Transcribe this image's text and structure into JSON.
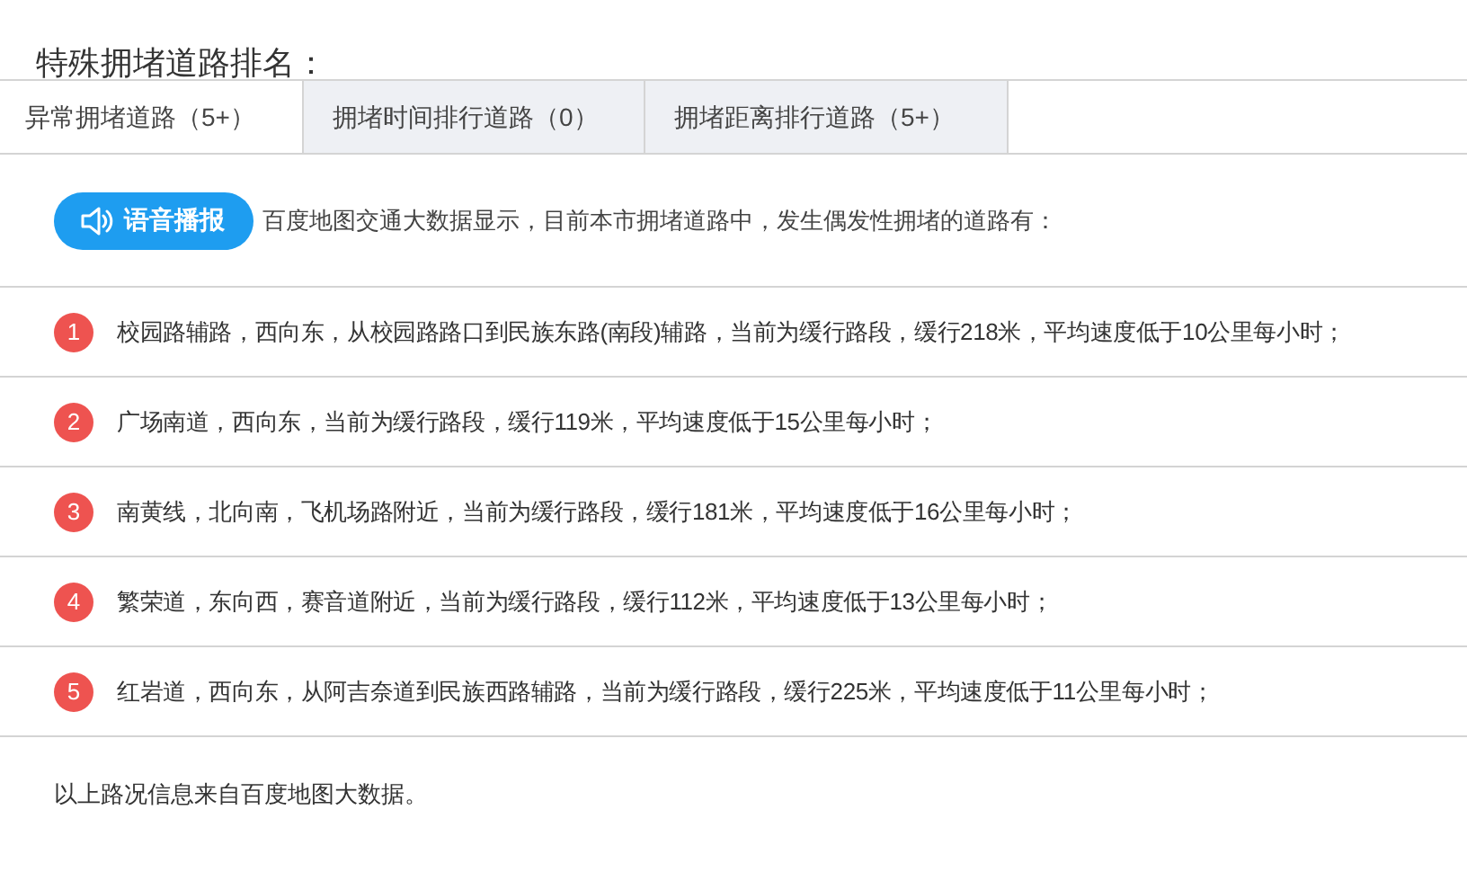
{
  "title": "特殊拥堵道路排名：",
  "tabs": [
    {
      "label": "异常拥堵道路（5+）",
      "selected": true
    },
    {
      "label": "拥堵时间排行道路（0）",
      "selected": false
    },
    {
      "label": "拥堵距离排行道路（5+）",
      "selected": false
    }
  ],
  "voice_button": {
    "label": "语音播报"
  },
  "intro": "百度地图交通大数据显示，目前本市拥堵道路中，发生偶发性拥堵的道路有：",
  "roads": [
    {
      "rank": "1",
      "text": "校园路辅路，西向东，从校园路路口到民族东路(南段)辅路，当前为缓行路段，缓行218米，平均速度低于10公里每小时；"
    },
    {
      "rank": "2",
      "text": "广场南道，西向东，当前为缓行路段，缓行119米，平均速度低于15公里每小时；"
    },
    {
      "rank": "3",
      "text": "南黄线，北向南，飞机场路附近，当前为缓行路段，缓行181米，平均速度低于16公里每小时；"
    },
    {
      "rank": "4",
      "text": "繁荣道，东向西，赛音道附近，当前为缓行路段，缓行112米，平均速度低于13公里每小时；"
    },
    {
      "rank": "5",
      "text": "红岩道，西向东，从阿吉奈道到民族西路辅路，当前为缓行路段，缓行225米，平均速度低于11公里每小时；"
    }
  ],
  "footer": "以上路况信息来自百度地图大数据。"
}
